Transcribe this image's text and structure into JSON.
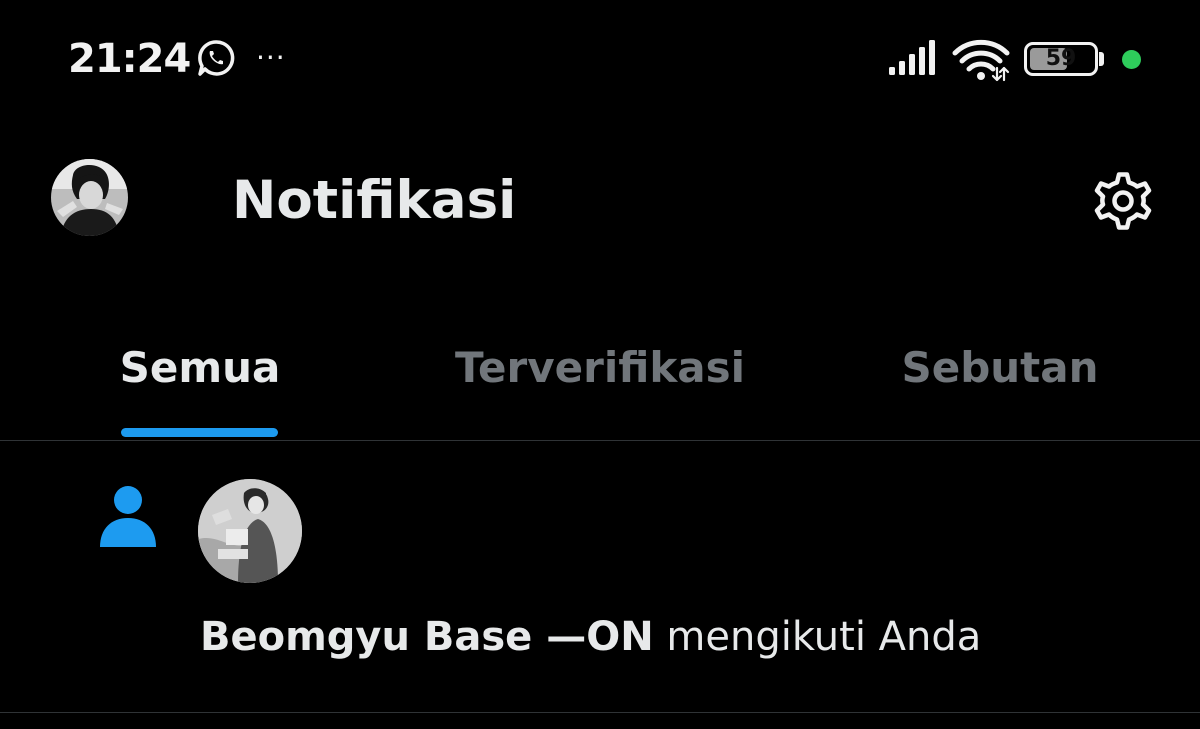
{
  "status_bar": {
    "time": "21:24",
    "notification_icons": [
      "whatsapp-icon",
      "more-icon"
    ],
    "more_glyph": "···",
    "signal_icon": "signal-icon",
    "wifi_icon": "wifi-icon",
    "battery_level": "59",
    "battery_fraction": 0.59,
    "dot_color": "#2ecc5b"
  },
  "header": {
    "title": "Notifikasi",
    "avatar_icon": "profile-avatar",
    "settings_icon": "gear-icon"
  },
  "tabs": [
    {
      "label": "Semua",
      "active": true
    },
    {
      "label": "Terverifikasi",
      "active": false
    },
    {
      "label": "Sebutan",
      "active": false
    }
  ],
  "colors": {
    "accent": "#1d9bf0",
    "tab_active": "#e7e9ea",
    "tab_inactive": "#71767b",
    "background": "#000000"
  },
  "notifications": [
    {
      "type_icon": "person-icon",
      "user_name": "Beomgyu Base —ON",
      "action": " mengikuti Anda"
    }
  ]
}
